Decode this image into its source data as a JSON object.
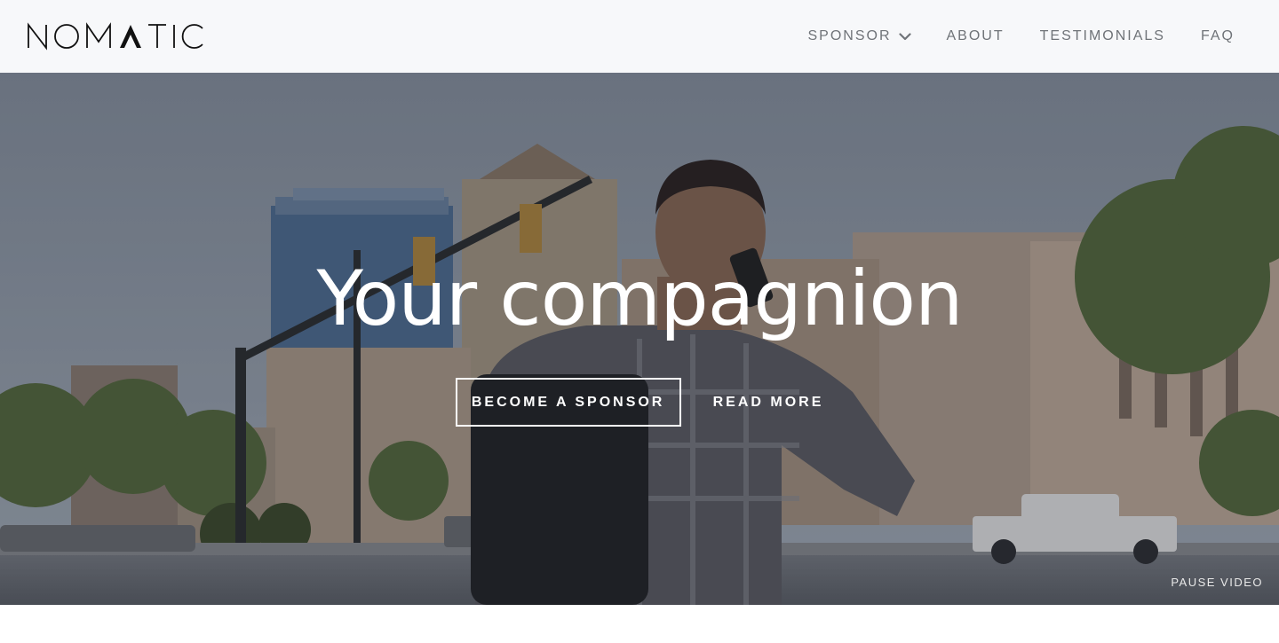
{
  "header": {
    "logo_text": "NOMATIC",
    "nav": [
      {
        "label": "SPONSOR",
        "has_dropdown": true
      },
      {
        "label": "ABOUT"
      },
      {
        "label": "TESTIMONIALS"
      },
      {
        "label": "FAQ"
      }
    ]
  },
  "hero": {
    "title": "Your compagnion",
    "primary_cta": "BECOME A SPONSOR",
    "secondary_cta": "READ MORE",
    "video_control": "PAUSE VIDEO"
  },
  "colors": {
    "header_bg": "#f7f8fa",
    "nav_text": "#6f7378",
    "hero_text": "#ffffff"
  },
  "icons": {
    "dropdown": "chevron-down-icon"
  }
}
